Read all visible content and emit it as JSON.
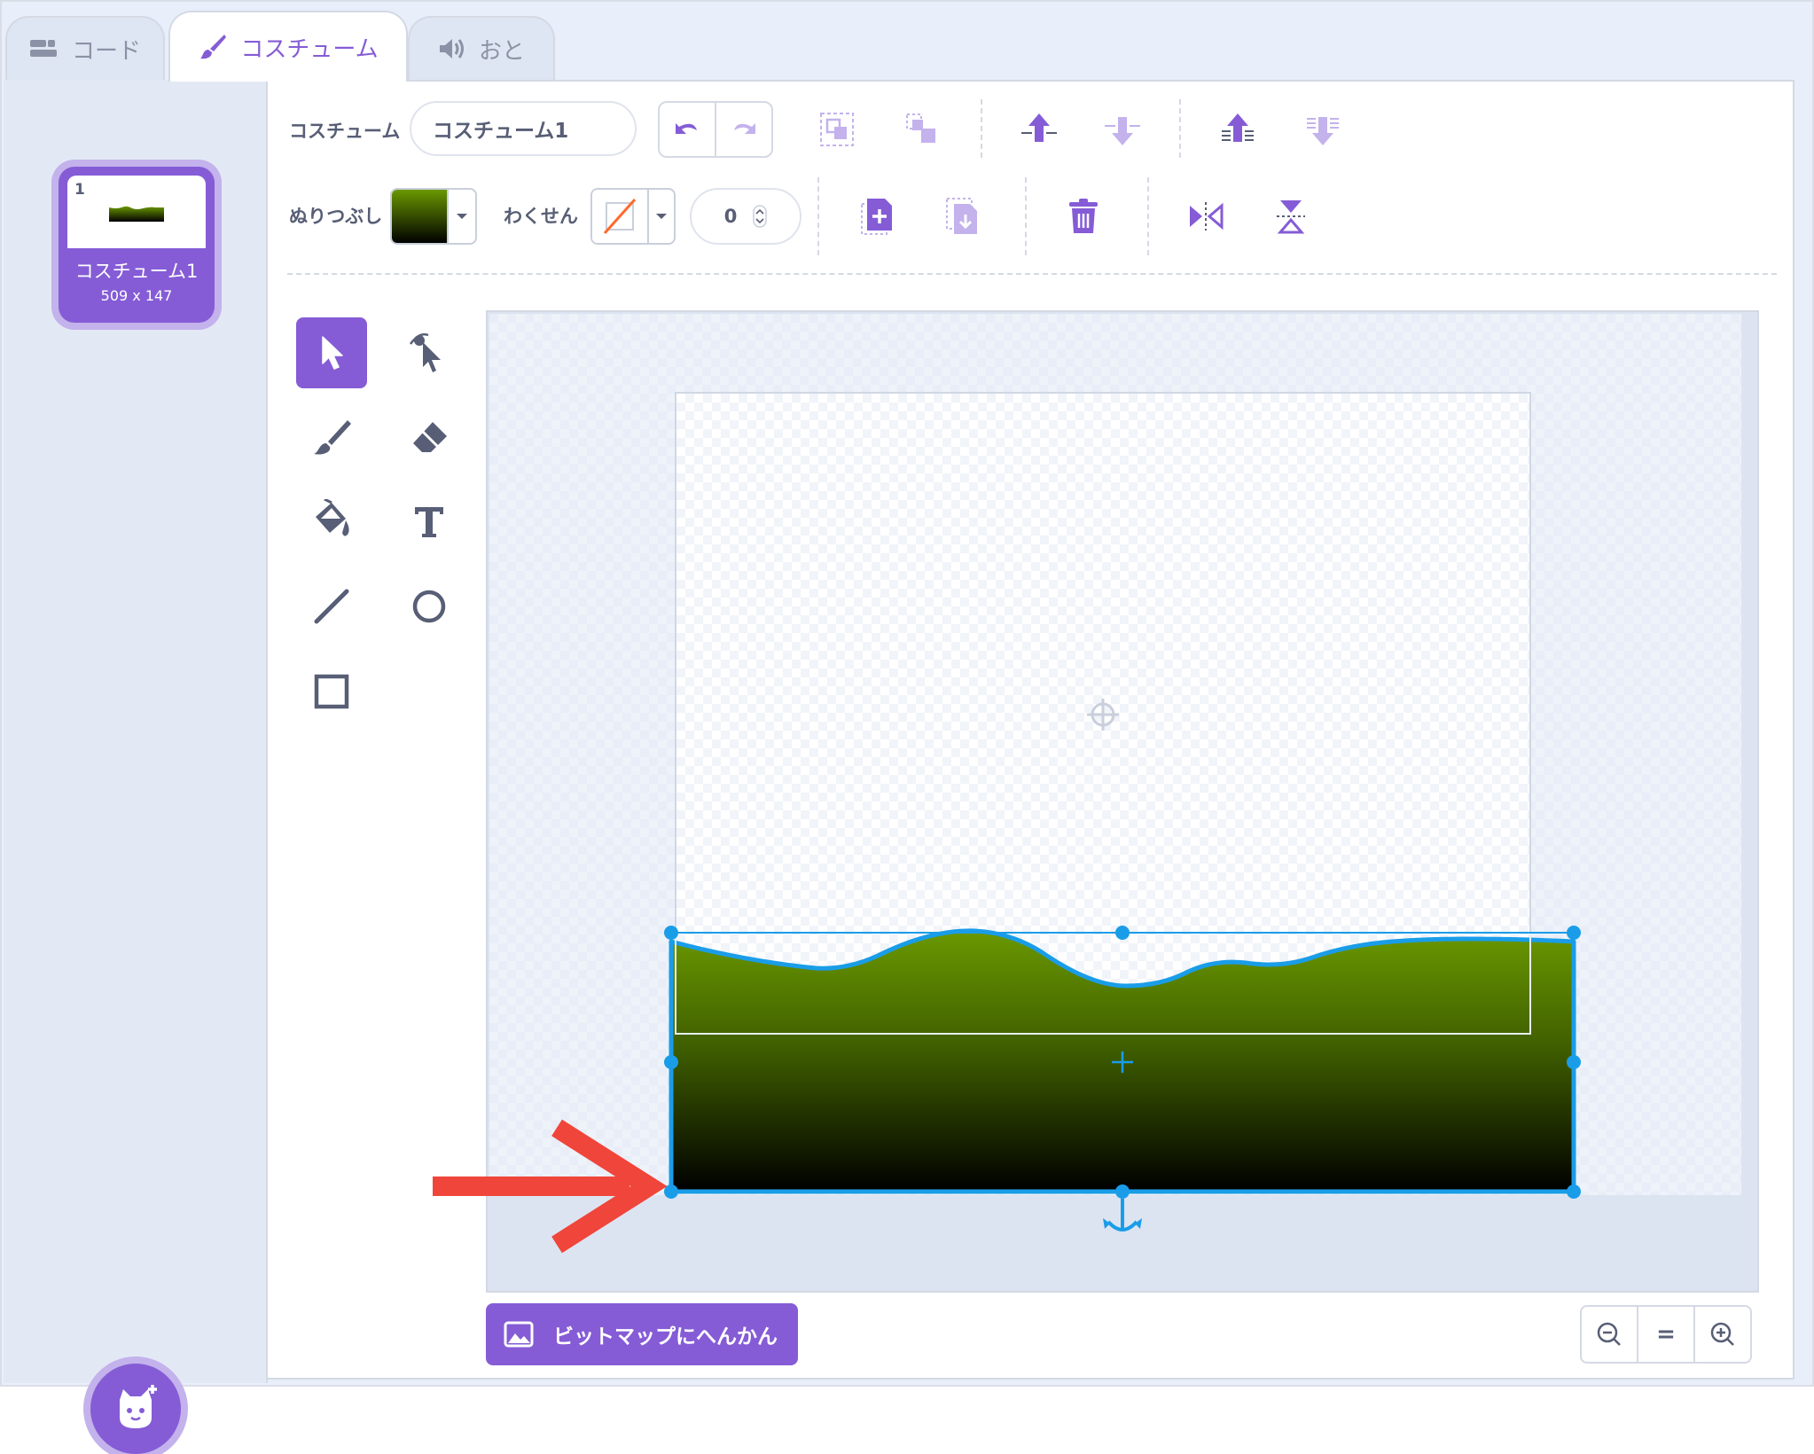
{
  "tabs": [
    {
      "label": "コード",
      "icon": "code-blocks-icon"
    },
    {
      "label": "コスチューム",
      "icon": "paintbrush-icon"
    },
    {
      "label": "おと",
      "icon": "speaker-icon"
    }
  ],
  "costume_list": {
    "items": [
      {
        "number": "1",
        "name": "コスチューム1",
        "size": "509 x 147"
      }
    ],
    "add_button_icon": "choose-costume-cat-icon"
  },
  "toolbar": {
    "costume_label": "コスチューム",
    "costume_name_value": "コスチューム1",
    "fill_label": "ぬりつぶし",
    "fill_color_top": "#6a9800",
    "fill_color_bottom": "#000000",
    "outline_label": "わくせん",
    "outline_width": "0",
    "icons": [
      "undo-icon",
      "redo-icon",
      "group-icon",
      "ungroup-icon",
      "forward-icon",
      "backward-icon",
      "front-icon",
      "back-icon",
      "copy-icon",
      "paste-icon",
      "delete-icon",
      "flip-horizontal-icon",
      "flip-vertical-icon"
    ]
  },
  "tools": [
    "select-tool",
    "reshape-tool",
    "brush-tool",
    "eraser-tool",
    "fill-tool",
    "text-tool",
    "line-tool",
    "circle-tool",
    "rectangle-tool"
  ],
  "footer": {
    "convert_button": "ビットマップにへんかん",
    "zoom_out": "−",
    "zoom_reset": "=",
    "zoom_in": "+"
  },
  "colors": {
    "accent": "#855cd6",
    "selection": "#1a9de8",
    "annotation_arrow": "#f0453a"
  }
}
